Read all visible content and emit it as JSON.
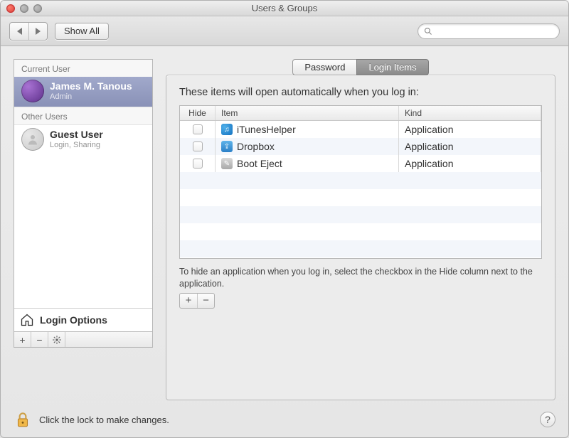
{
  "window": {
    "title": "Users & Groups"
  },
  "toolbar": {
    "show_all": "Show All",
    "search_placeholder": ""
  },
  "sidebar": {
    "current_user_header": "Current User",
    "other_users_header": "Other Users",
    "login_options": "Login Options",
    "users": [
      {
        "name": "James M. Tanous",
        "role": "Admin",
        "selected": true
      },
      {
        "name": "Guest User",
        "role": "Login, Sharing",
        "selected": false
      }
    ]
  },
  "tabs": {
    "password": "Password",
    "login_items": "Login Items",
    "active": "login_items"
  },
  "login_items": {
    "intro": "These items will open automatically when you log in:",
    "columns": {
      "hide": "Hide",
      "item": "Item",
      "kind": "Kind"
    },
    "rows": [
      {
        "hide": false,
        "name": "iTunesHelper",
        "kind": "Application",
        "icon": "itunes"
      },
      {
        "hide": false,
        "name": "Dropbox",
        "kind": "Application",
        "icon": "dropbox"
      },
      {
        "hide": false,
        "name": "Boot Eject",
        "kind": "Application",
        "icon": "booteject"
      }
    ],
    "hint": "To hide an application when you log in, select the checkbox in the Hide column next to the application."
  },
  "footer": {
    "lock_text": "Click the lock to make changes."
  },
  "glyphs": {
    "plus": "+",
    "minus": "−",
    "gear": "✻",
    "question": "?",
    "note": "♫",
    "box": "⇪",
    "wrench": "✎"
  }
}
